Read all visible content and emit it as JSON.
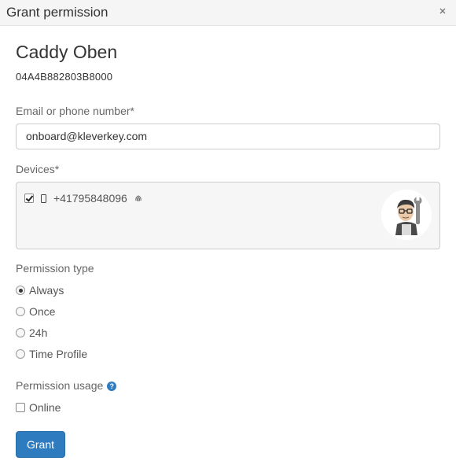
{
  "dialog": {
    "title": "Grant permission"
  },
  "lock": {
    "name": "Caddy Oben",
    "serial": "04A4B882803B8000"
  },
  "contact": {
    "label": "Email or phone number*",
    "value": "onboard@kleverkey.com"
  },
  "devices": {
    "label": "Devices*",
    "items": [
      {
        "number": "+41795848096",
        "checked": true,
        "icons": [
          "phone-icon",
          "fingerprint-icon"
        ]
      }
    ],
    "avatar_icon": "mechanic-avatar"
  },
  "permission_type": {
    "label": "Permission type",
    "options": [
      {
        "label": "Always",
        "selected": true
      },
      {
        "label": "Once",
        "selected": false
      },
      {
        "label": "24h",
        "selected": false
      },
      {
        "label": "Time Profile",
        "selected": false
      }
    ]
  },
  "permission_usage": {
    "label": "Permission usage",
    "help_icon": "question-icon",
    "online_label": "Online",
    "online_checked": false
  },
  "actions": {
    "grant_label": "Grant"
  },
  "colors": {
    "primary": "#2f7bbf",
    "titlebar_bg": "#f5f5f5",
    "devices_bg": "#f6f6f6"
  }
}
